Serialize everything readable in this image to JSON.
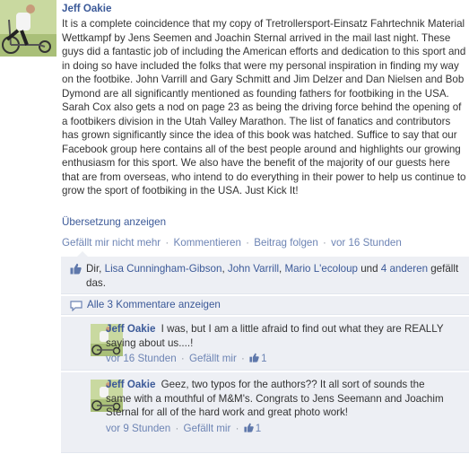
{
  "post": {
    "author": "Jeff Oakie",
    "text": "It is a complete coincidence that my copy of Tretrollersport-Einsatz Fahrtechnik Material Wettkampf by Jens Seemen and Joachin Sternal arrived in the mail last night. These guys did a fantastic job of including the American efforts and dedication to this sport and in doing so have included the folks that were my personal inspiration in finding my way on the footbike. John Varrill and Gary Schmitt and Jim Delzer and Dan Nielsen and Bob Dymond are all significantly mentioned as founding fathers for footbiking in the USA. Sarah Cox also gets a nod on page 23 as being the driving force behind the opening of a footbikers division in the Utah Valley Marathon. The list of fanatics and contributors has grown significantly since the idea of this book was hatched. Suffice to say that our Facebook group here contains all of the best people around and highlights our growing enthusiasm for this sport. We also have the benefit of the majority of our guests here that are from overseas, who intend to do everything in their power to help us continue to grow the sport of footbiking in the USA. Just Kick It!",
    "translate_label": "Übersetzung anzeigen",
    "actions": {
      "unlike": "Gefällt mir nicht mehr",
      "comment": "Kommentieren",
      "follow": "Beitrag folgen",
      "time": "vor 16 Stunden",
      "separator": "·"
    }
  },
  "likes": {
    "you": "Dir, ",
    "people": [
      "Lisa Cunningham-Gibson",
      "John Varrill",
      "Mario L'ecoloup"
    ],
    "sep": ", ",
    "and": " und ",
    "others": "4 anderen",
    "suffix": " gefällt das."
  },
  "view_all_comments": "Alle 3 Kommentare anzeigen",
  "comments": [
    {
      "author": "Jeff Oakie",
      "text": "I was, but I am a little afraid to find out what they are REALLY saying about us....!",
      "time": "vor 16 Stunden",
      "like_label": "Gefällt mir",
      "like_count": "1"
    },
    {
      "author": "Jeff Oakie",
      "text": "Geez, two typos for the authors?? It all sort of sounds the same with a mouthful of M&M's. Congrats to Jens Seemann and Joachim Sternal for all of the hard work and great photo work!",
      "time": "vor 9 Stunden",
      "like_label": "Gefällt mir",
      "like_count": "1"
    }
  ],
  "colors": {
    "link": "#3b5998",
    "ufi_background": "#edeff4",
    "meta": "#7f7f7f"
  }
}
